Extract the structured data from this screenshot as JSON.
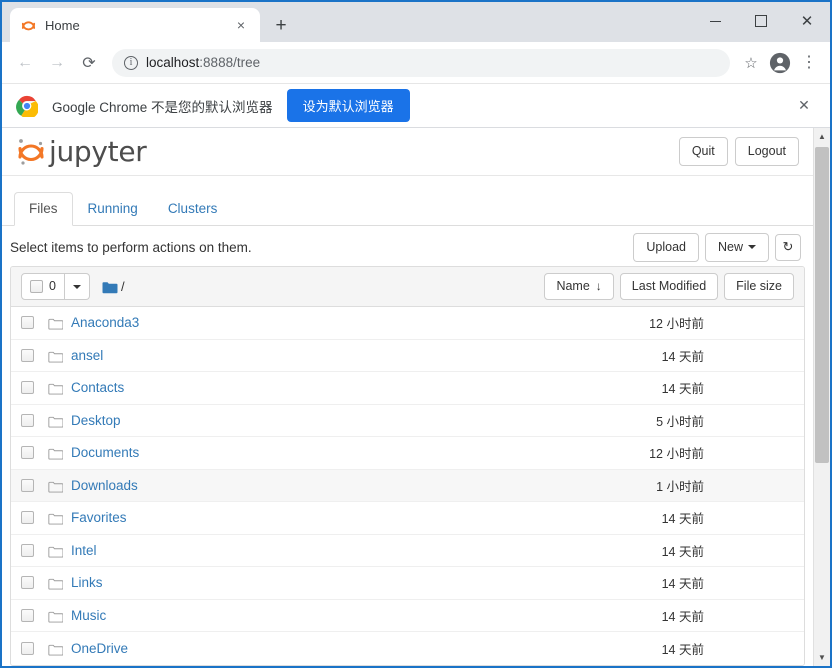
{
  "browser": {
    "tab": {
      "title": "Home",
      "favicon": "jupyter-favicon",
      "close_label": "×"
    },
    "new_tab_label": "+",
    "window_controls": {
      "minimize": "—",
      "maximize": "□",
      "close": "✕"
    },
    "nav": {
      "back": "←",
      "forward": "→",
      "reload": "⟳"
    },
    "omnibox": {
      "security_icon": "info-icon",
      "url_host": "localhost",
      "url_rest": ":8888/tree"
    },
    "star_icon": "☆",
    "menu_icon": "⋮"
  },
  "infobar": {
    "logo": "chrome-logo",
    "message": "Google Chrome 不是您的默认浏览器",
    "button_label": "设为默认浏览器",
    "close_label": "✕"
  },
  "jupyter": {
    "brand": "jupyter",
    "header_buttons": [
      {
        "label": "Quit",
        "name": "quit-button"
      },
      {
        "label": "Logout",
        "name": "logout-button"
      }
    ],
    "tabs": [
      {
        "label": "Files",
        "active": true
      },
      {
        "label": "Running",
        "active": false
      },
      {
        "label": "Clusters",
        "active": false
      }
    ],
    "toolbar": {
      "select_message": "Select items to perform actions on them.",
      "upload_label": "Upload",
      "new_label": "New",
      "refresh_icon": "↻"
    },
    "list_header": {
      "selected_count": "0",
      "breadcrumb_root": "/",
      "sort_name": "Name",
      "sort_name_arrow": "↓",
      "sort_modified": "Last Modified",
      "sort_filesize": "File size"
    },
    "rows": [
      {
        "name": "Anaconda3",
        "modified": "12 小时前",
        "hover": false
      },
      {
        "name": "ansel",
        "modified": "14 天前",
        "hover": false
      },
      {
        "name": "Contacts",
        "modified": "14 天前",
        "hover": false
      },
      {
        "name": "Desktop",
        "modified": "5 小时前",
        "hover": false
      },
      {
        "name": "Documents",
        "modified": "12 小时前",
        "hover": false
      },
      {
        "name": "Downloads",
        "modified": "1 小时前",
        "hover": true
      },
      {
        "name": "Favorites",
        "modified": "14 天前",
        "hover": false
      },
      {
        "name": "Intel",
        "modified": "14 天前",
        "hover": false
      },
      {
        "name": "Links",
        "modified": "14 天前",
        "hover": false
      },
      {
        "name": "Music",
        "modified": "14 天前",
        "hover": false
      },
      {
        "name": "OneDrive",
        "modified": "14 天前",
        "hover": false
      }
    ]
  },
  "colors": {
    "accent_blue": "#1a73e8",
    "link_blue": "#337ab7",
    "jupyter_orange": "#f37726",
    "window_border": "#1a73c7",
    "tabstrip_bg": "#dee1e6"
  }
}
